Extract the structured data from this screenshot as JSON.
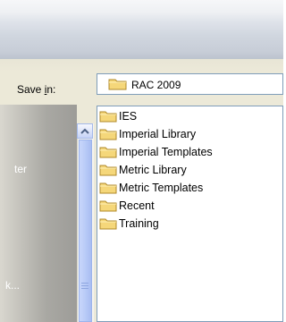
{
  "save_in": {
    "label_prefix": "Save ",
    "label_accel": "i",
    "label_suffix": "n:",
    "folder": "RAC 2009",
    "folder_icon": "folder-icon"
  },
  "places_bar": {
    "partial_label_1": "ter",
    "partial_label_2": "k..."
  },
  "files": [
    {
      "name": "IES",
      "icon": "folder-icon"
    },
    {
      "name": "Imperial Library",
      "icon": "folder-icon"
    },
    {
      "name": "Imperial Templates",
      "icon": "folder-icon"
    },
    {
      "name": "Metric Library",
      "icon": "folder-icon"
    },
    {
      "name": "Metric Templates",
      "icon": "folder-icon"
    },
    {
      "name": "Recent",
      "icon": "folder-icon"
    },
    {
      "name": "Training",
      "icon": "folder-icon"
    }
  ],
  "colors": {
    "folder_fill": "#f5d77a",
    "folder_stroke": "#b08a2a",
    "scrollbar_thumb": "#b9cbf7"
  }
}
